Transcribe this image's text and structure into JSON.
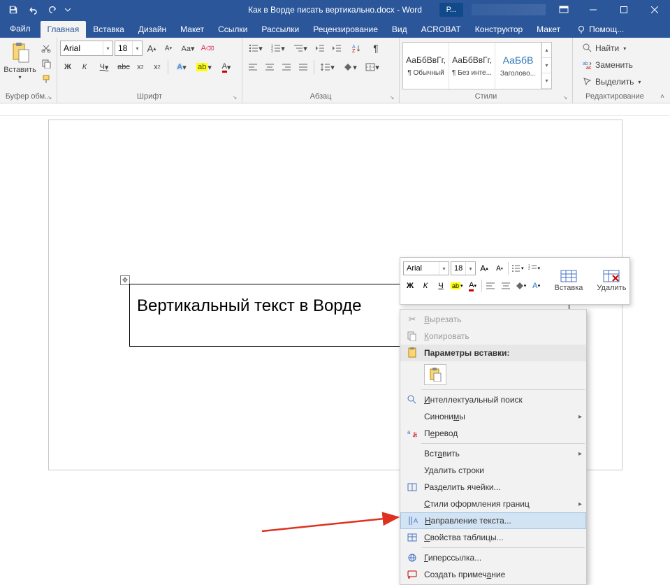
{
  "titlebar": {
    "title": "Как в Ворде писать вертикально.docx - Word",
    "user_badge": "Р..."
  },
  "tabs": {
    "file": "Файл",
    "items": [
      "Главная",
      "Вставка",
      "Дизайн",
      "Макет",
      "Ссылки",
      "Рассылки",
      "Рецензирование",
      "Вид",
      "ACROBAT",
      "Конструктор",
      "Макет"
    ],
    "active_index": 0,
    "tell_me": "Помощ..."
  },
  "ribbon": {
    "clipboard": {
      "label": "Буфер обм...",
      "paste": "Вставить"
    },
    "font": {
      "label": "Шрифт",
      "name": "Arial",
      "size": "18",
      "bold": "Ж",
      "italic": "К",
      "underline": "Ч",
      "strike": "abc",
      "sub": "x₂",
      "sup": "x²",
      "case": "Aa",
      "clear": "A",
      "grow": "A",
      "shrink": "A"
    },
    "paragraph": {
      "label": "Абзац"
    },
    "styles": {
      "label": "Стили",
      "items": [
        {
          "preview": "АаБбВвГг,",
          "name": "¶ Обычный"
        },
        {
          "preview": "АаБбВвГг,",
          "name": "¶ Без инте..."
        },
        {
          "preview": "АаБбВ",
          "name": "Заголово..."
        }
      ]
    },
    "editing": {
      "label": "Редактирование",
      "find": "Найти",
      "replace": "Заменить",
      "select": "Выделить"
    }
  },
  "document": {
    "text": "Вертикальный текст в Ворде"
  },
  "mini_toolbar": {
    "font_name": "Arial",
    "font_size": "18",
    "bold": "Ж",
    "italic": "К",
    "underline": "Ч",
    "insert": "Вставка",
    "delete": "Удалить"
  },
  "context_menu": {
    "cut": "Вырезать",
    "copy": "Копировать",
    "paste_header": "Параметры вставки:",
    "smart_lookup": "Интеллектуальный поиск",
    "synonyms": "Синонимы",
    "translate": "Перевод",
    "insert": "Вставить",
    "delete_rows": "Удалить строки",
    "split_cells": "Разделить ячейки...",
    "border_styles": "Стили оформления границ",
    "text_direction": "Направление текста...",
    "table_props": "Свойства таблицы...",
    "hyperlink": "Гиперссылка...",
    "new_comment": "Создать примечание"
  }
}
